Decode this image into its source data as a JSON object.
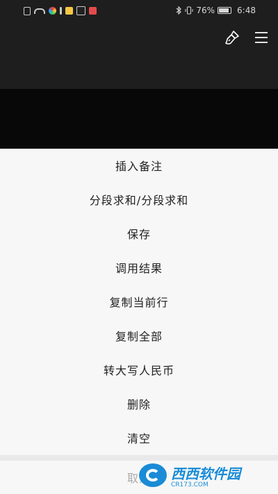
{
  "status_bar": {
    "battery_percent": "76%",
    "time": "6:48"
  },
  "menu": {
    "items": [
      {
        "label": "插入备注"
      },
      {
        "label": "分段求和/分段求和"
      },
      {
        "label": "保存"
      },
      {
        "label": "调用结果"
      },
      {
        "label": "复制当前行"
      },
      {
        "label": "复制全部"
      },
      {
        "label": "转大写人民币"
      },
      {
        "label": "删除"
      },
      {
        "label": "清空"
      }
    ],
    "cancel": "取消"
  },
  "watermark": {
    "title": "西西软件园",
    "url": "CR173.COM"
  },
  "colors": {
    "dark_bg": "#1e1e1e",
    "sheet_bg": "#f7f7f7",
    "watermark_blue": "#1a8bd6"
  }
}
